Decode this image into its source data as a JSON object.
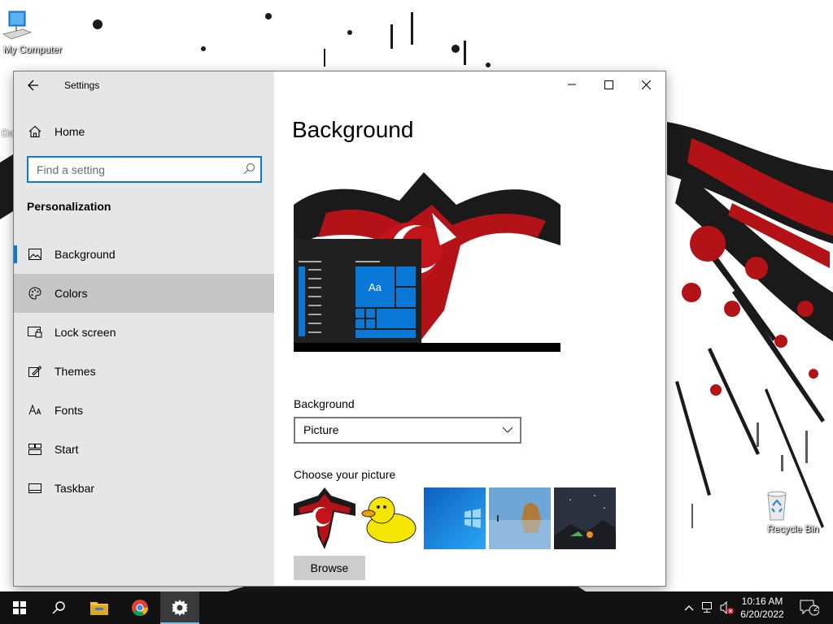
{
  "desktop": {
    "icons": [
      {
        "label": "My Computer",
        "icon": "computer-icon"
      },
      {
        "label": "Recycle Bin",
        "icon": "recycle-bin-icon"
      }
    ],
    "partial_label": "Da"
  },
  "window": {
    "title": "Settings",
    "home_label": "Home",
    "search_placeholder": "Find a setting",
    "section": "Personalization",
    "nav": [
      {
        "label": "Background",
        "icon": "picture-icon"
      },
      {
        "label": "Colors",
        "icon": "palette-icon"
      },
      {
        "label": "Lock screen",
        "icon": "lock-screen-icon"
      },
      {
        "label": "Themes",
        "icon": "themes-icon"
      },
      {
        "label": "Fonts",
        "icon": "fonts-icon"
      },
      {
        "label": "Start",
        "icon": "start-icon"
      },
      {
        "label": "Taskbar",
        "icon": "taskbar-icon"
      }
    ],
    "page_title": "Background",
    "preview_tile_text": "Aa",
    "background_label": "Background",
    "background_value": "Picture",
    "choose_label": "Choose your picture",
    "browse_label": "Browse",
    "colors": {
      "accent": "#0a78d7",
      "sidebar": "#e6e6e6",
      "hover": "#c6c6c6"
    }
  },
  "taskbar": {
    "time": "10:16 AM",
    "date": "6/20/2022",
    "notification_count": "2"
  }
}
